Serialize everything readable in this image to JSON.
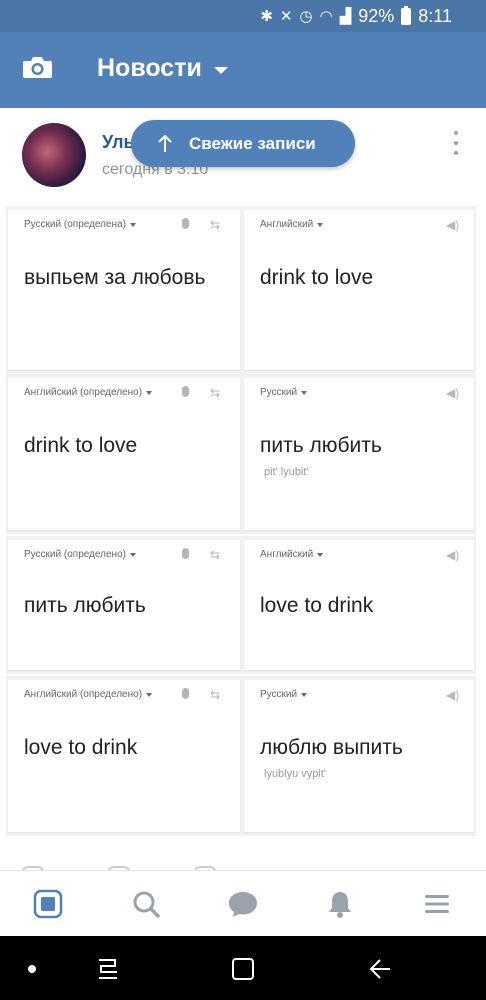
{
  "status_bar": {
    "battery": "92%",
    "time": "8:11",
    "icons": [
      "bluetooth-icon",
      "mute-icon",
      "alarm-icon",
      "wifi-icon",
      "signal-icon",
      "battery-icon"
    ]
  },
  "app_bar": {
    "title": "Новости",
    "camera_icon": "camera-icon",
    "dropdown_icon": "caret-down-icon"
  },
  "post": {
    "author": "Уль",
    "time": "сегодня в 3:10"
  },
  "fresh_button": {
    "label": "Свежие записи",
    "icon": "arrow-up-icon"
  },
  "translations": [
    {
      "source_lang": "Русский (определена)",
      "target_lang": "Английский",
      "source_text": "выпьем за любовь",
      "target_text": "drink to love",
      "translit": ""
    },
    {
      "source_lang": "Английский (определено)",
      "target_lang": "Русский",
      "source_text": "drink to love",
      "target_text": "пить любить",
      "translit": "pit' lyubit'"
    },
    {
      "source_lang": "Русский (определено)",
      "target_lang": "Английский",
      "source_text": "пить любить",
      "target_text": "love to drink",
      "translit": ""
    },
    {
      "source_lang": "Английский (определено)",
      "target_lang": "Русский",
      "source_text": "love to drink",
      "target_text": "люблю выпить",
      "translit": "lyublyu vypit'"
    }
  ],
  "bottom_nav": [
    "news-icon",
    "search-icon",
    "messages-icon",
    "notifications-icon",
    "menu-icon"
  ],
  "colors": {
    "header": "#5181b8",
    "status_bar": "#4a76a8",
    "link": "#2a5885"
  }
}
